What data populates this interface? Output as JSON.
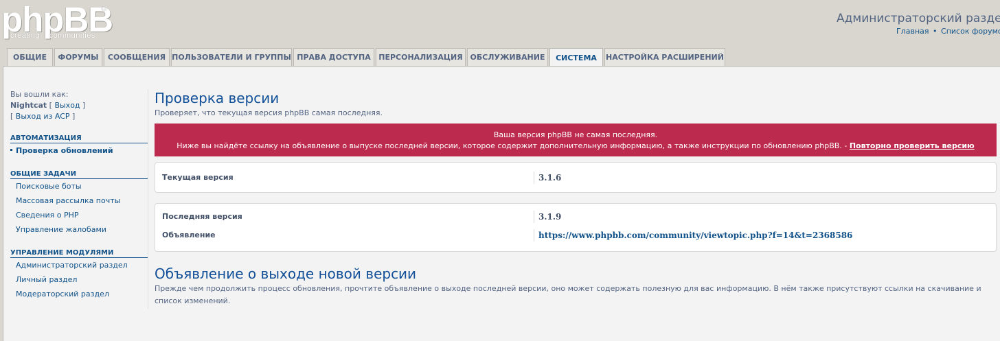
{
  "header": {
    "logo_text": "phpBB",
    "logo_reg": "®",
    "logo_tagline": "creating communities",
    "site_title": "Администраторский раздел",
    "links": [
      "Главная",
      "Список форумов"
    ],
    "link_separator": "•"
  },
  "tabs": [
    {
      "label": "Общие",
      "active": false
    },
    {
      "label": "Форумы",
      "active": false
    },
    {
      "label": "Сообщения",
      "active": false
    },
    {
      "label": "Пользователи и группы",
      "active": false
    },
    {
      "label": "Права доступа",
      "active": false
    },
    {
      "label": "Персонализация",
      "active": false
    },
    {
      "label": "Обслуживание",
      "active": false
    },
    {
      "label": "Система",
      "active": true
    },
    {
      "label": "Настройка расширений",
      "active": false
    }
  ],
  "sidebar": {
    "logged_in_as": "Вы вошли как:",
    "username": "Nightcat",
    "logout": "Выход",
    "exit_acp": "Выход из ACP",
    "sections": [
      {
        "title": "Автоматизация",
        "items": [
          {
            "label": "Проверка обновлений",
            "active": true
          }
        ]
      },
      {
        "title": "Общие задачи",
        "items": [
          {
            "label": "Поисковые боты",
            "active": false
          },
          {
            "label": "Массовая рассылка почты",
            "active": false
          },
          {
            "label": "Сведения о PHP",
            "active": false
          },
          {
            "label": "Управление жалобами",
            "active": false
          }
        ]
      },
      {
        "title": "Управление модулями",
        "items": [
          {
            "label": "Администраторский раздел",
            "active": false
          },
          {
            "label": "Личный раздел",
            "active": false
          },
          {
            "label": "Модераторский раздел",
            "active": false
          }
        ]
      }
    ]
  },
  "main": {
    "title": "Проверка версии",
    "description": "Проверяет, что текущая версия phpBB самая последняя.",
    "error": {
      "line1": "Ваша версия phpBB не самая последняя.",
      "line2": "Ниже вы найдёте ссылку на объявление о выпуске последней версии, которое содержит дополнительную информацию, а также инструкции по обновлению phpBB. -",
      "recheck_link": "Повторно проверить версию",
      "color": "#bc2a4d"
    },
    "current": {
      "label": "Текущая версия",
      "value": "3.1.6"
    },
    "latest": {
      "label": "Последняя версия",
      "value": "3.1.9"
    },
    "announcement": {
      "label": "Объявление",
      "value": "https://www.phpbb.com/community/viewtopic.php?f=14&t=2368586"
    },
    "section_title": "Объявление о выходе новой версии",
    "section_text": "Прежде чем продолжить процесс обновления, прочтите объявление о выходе последней версии, оно может содержать полезную для вас информацию. В нём также присутствуют ссылки на скачивание и список изменений."
  }
}
